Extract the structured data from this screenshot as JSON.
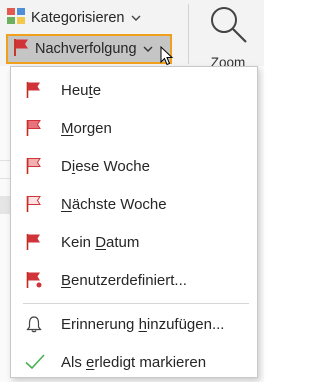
{
  "ribbon": {
    "categorize": {
      "label": "Kategorisieren",
      "icon": "categories-icon",
      "chevron": "chevron-down-icon"
    },
    "followup": {
      "label": "Nachverfolgung",
      "icon": "red-flag-icon",
      "chevron": "chevron-down-icon",
      "highlight_color": "#f0a11b"
    },
    "zoom": {
      "label": "Zoom",
      "icon": "magnifier-icon"
    }
  },
  "menu": {
    "items": [
      {
        "pre": "Heu",
        "acc": "t",
        "post": "e",
        "icon": "flag-today-icon"
      },
      {
        "pre": "",
        "acc": "M",
        "post": "orgen",
        "icon": "flag-tomorrow-icon"
      },
      {
        "pre": "D",
        "acc": "i",
        "post": "ese Woche",
        "icon": "flag-this-week-icon"
      },
      {
        "pre": "",
        "acc": "N",
        "post": "ächste Woche",
        "icon": "flag-next-week-icon"
      },
      {
        "pre": "Kein ",
        "acc": "D",
        "post": "atum",
        "icon": "flag-no-date-icon"
      },
      {
        "pre": "",
        "acc": "B",
        "post": "enutzerdefiniert...",
        "icon": "flag-custom-icon"
      },
      {
        "pre": "Erinnerung ",
        "acc": "h",
        "post": "inzufügen...",
        "icon": "bell-icon"
      },
      {
        "pre": "Als ",
        "acc": "e",
        "post": "rledigt markieren",
        "icon": "checkmark-icon"
      }
    ]
  },
  "colors": {
    "flag_red": "#d13438",
    "check_green": "#4caf50",
    "menu_border": "#c8c8c8"
  }
}
